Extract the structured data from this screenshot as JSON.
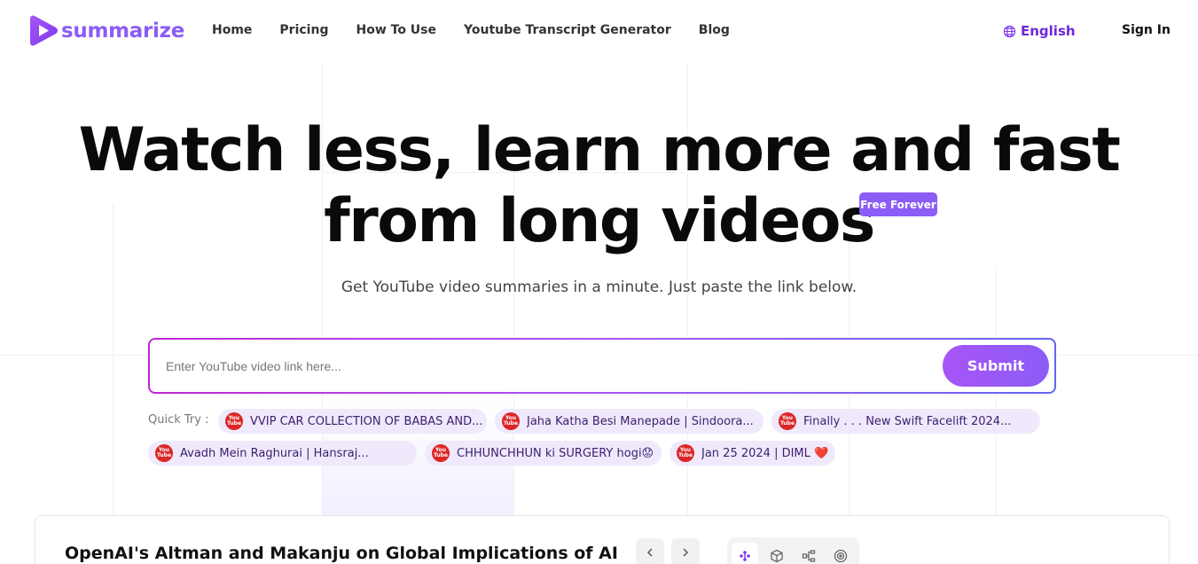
{
  "brand": {
    "name": "summarize",
    "color": "#8b5cf6"
  },
  "nav": {
    "items": [
      "Home",
      "Pricing",
      "How To Use",
      "Youtube Transcript Generator",
      "Blog"
    ],
    "language": "English",
    "signin": "Sign In"
  },
  "hero": {
    "line1": "Watch less, learn more and fast",
    "line2": "from long videos",
    "badge": "Free Forever",
    "subtitle": "Get YouTube video summaries in a minute. Just paste the link below."
  },
  "search": {
    "placeholder": "Enter YouTube video link here...",
    "value": "",
    "submit_label": "Submit"
  },
  "quick_try": {
    "label": "Quick Try :",
    "items": [
      {
        "title": "VVIP CAR COLLECTION OF BABAS AND..."
      },
      {
        "title": "Jaha Katha Besi Manepade | Sindoora..."
      },
      {
        "title": "Finally . . . New Swift Facelift 2024..."
      },
      {
        "title": "Avadh Mein Raghurai | Hansraj..."
      },
      {
        "title": "CHHUNCHHUN ki SURGERY hogi😟"
      },
      {
        "title": "Jan 25 2024 | DIML ❤️"
      }
    ]
  },
  "card": {
    "title": "OpenAI's Altman and Makanju on Global Implications of AI"
  },
  "icons": {
    "logo": "play-logo-icon",
    "language": "globe-icon",
    "youtube": "youtube-icon",
    "prev": "chevron-left-icon",
    "next": "chevron-right-icon",
    "tools": [
      "sparkle-icon",
      "cube-icon",
      "mindmap-icon",
      "target-icon"
    ]
  }
}
